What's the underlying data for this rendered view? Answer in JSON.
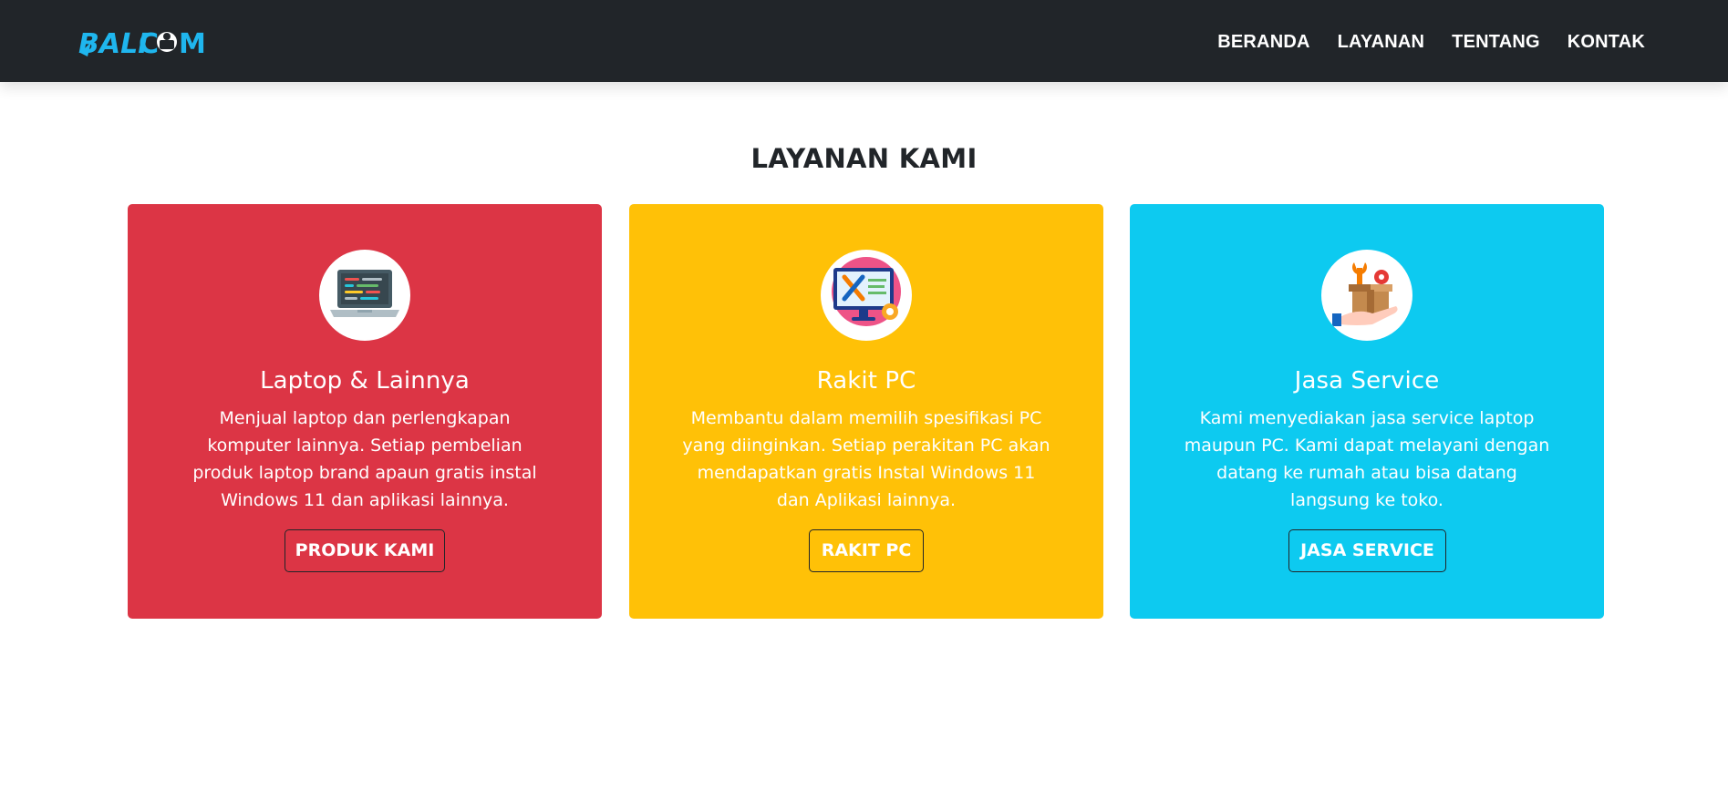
{
  "brand": {
    "logo_text": "BALI COM",
    "logo_color": "#1fb6ee"
  },
  "nav": {
    "items": [
      {
        "label": "BERANDA"
      },
      {
        "label": "LAYANAN"
      },
      {
        "label": "TENTANG"
      },
      {
        "label": "KONTAK"
      }
    ]
  },
  "section": {
    "title": "LAYANAN KAMI"
  },
  "cards": [
    {
      "title": "Laptop & Lainnya",
      "text": "Menjual laptop dan perlengkapan komputer lainnya. Setiap pembelian produk laptop brand apaun gratis instal Windows 11 dan aplikasi lainnya.",
      "button": "PRODUK KAMI",
      "icon": "laptop-icon",
      "color": "#dc3545"
    },
    {
      "title": "Rakit PC",
      "text": "Membantu dalam memilih spesifikasi PC yang diinginkan. Setiap perakitan PC akan mendapatkan gratis Instal Windows 11 dan Aplikasi lainnya.",
      "button": "RAKIT PC",
      "icon": "pc-tools-icon",
      "color": "#ffc107"
    },
    {
      "title": "Jasa Service",
      "text": "Kami menyediakan jasa service laptop maupun PC. Kami dapat melayani dengan datang ke rumah atau bisa datang langsung ke toko.",
      "button": "JASA SERVICE",
      "icon": "service-box-icon",
      "color": "#0dcaf0"
    }
  ]
}
